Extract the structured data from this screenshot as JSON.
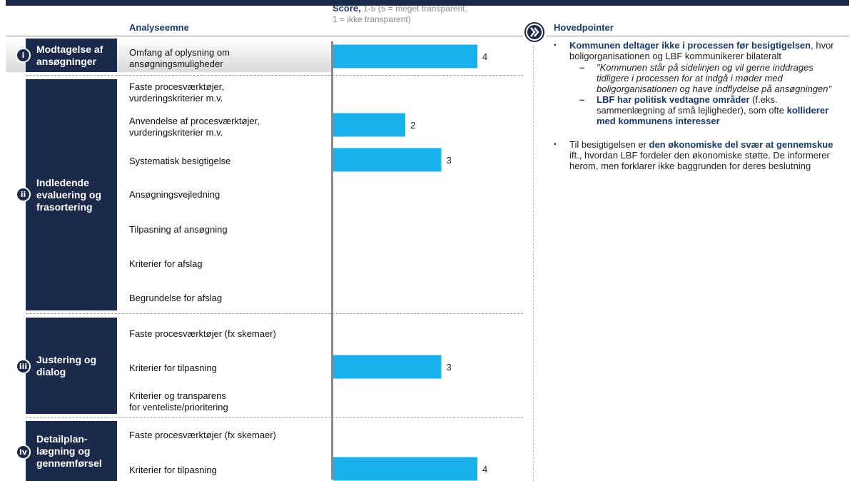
{
  "header": {
    "analyseemne": "Analyseemne",
    "score_bold": "Score,",
    "score_rest1": " 1-5 (5 = meget transparent,",
    "score_rest2": "1 = ikke transparent)",
    "hovedpointer": "Hovedpointer"
  },
  "sections": [
    {
      "roman": "i",
      "line1": "Modtagelse af",
      "line2": "ansøgninger",
      "line3": ""
    },
    {
      "roman": "ii",
      "line1": "Indledende",
      "line2": "evaluering og",
      "line3": "frasortering"
    },
    {
      "roman": "iii",
      "line1": "Justering og",
      "line2": "dialog",
      "line3": ""
    },
    {
      "roman": "iv",
      "line1": "Detailplan-",
      "line2": "lægning og",
      "line3": "gennemførsel"
    }
  ],
  "items": [
    {
      "l1": "Omfang af oplysning om",
      "l2": "ansøgningsmuligheder"
    },
    {
      "l1": "Faste procesværktøjer,",
      "l2": "vurderingskriterier m.v."
    },
    {
      "l1": "Anvendelse af procesværktøjer,",
      "l2": "vurderingskriterier m.v."
    },
    {
      "l1": "Systematisk besigtigelse",
      "l2": ""
    },
    {
      "l1": "Ansøgningsvejledning",
      "l2": ""
    },
    {
      "l1": "Tilpasning af ansøgning",
      "l2": ""
    },
    {
      "l1": "Kriterier for afslag",
      "l2": ""
    },
    {
      "l1": "Begrundelse for afslag",
      "l2": ""
    },
    {
      "l1": "Faste procesværktøjer (fx skemaer)",
      "l2": ""
    },
    {
      "l1": "Kriterier for tilpasning",
      "l2": ""
    },
    {
      "l1": "Kriterier og transparens",
      "l2": "for venteliste/prioritering"
    },
    {
      "l1": "Faste procesværktøjer (fx skemaer)",
      "l2": ""
    },
    {
      "l1": "Kriterier for tilpasning",
      "l2": ""
    }
  ],
  "chart_data": {
    "type": "bar",
    "orientation": "horizontal",
    "xlabel": "Score, 1-5 (5 = meget transparent, 1 = ikke transparent)",
    "xlim": [
      0,
      5
    ],
    "bar_color": "#1ab0ec",
    "categories": [
      "Omfang af oplysning om ansøgningsmuligheder",
      "Faste procesværktøjer, vurderingskriterier m.v.",
      "Anvendelse af procesværktøjer, vurderingskriterier m.v.",
      "Systematisk besigtigelse",
      "Ansøgningsvejledning",
      "Tilpasning af ansøgning",
      "Kriterier for afslag",
      "Begrundelse for afslag",
      "Faste procesværktøjer (fx skemaer)",
      "Kriterier for tilpasning",
      "Kriterier og transparens for venteliste/prioritering",
      "Faste procesværktøjer (fx skemaer)",
      "Kriterier for tilpasning"
    ],
    "values": [
      4,
      null,
      2,
      3,
      null,
      null,
      null,
      null,
      null,
      3,
      null,
      null,
      4
    ],
    "value_labels": [
      "4",
      "",
      "2",
      "3",
      "",
      "",
      "",
      "",
      "",
      "3",
      "",
      "",
      "4"
    ]
  },
  "notes": {
    "n1_bold": "Kommunen deltager ikke i processen før besigtigelsen",
    "n1_rest": ", hvor boligorganisationen og LBF kommunikerer bilateralt",
    "s1_dash": "–",
    "s1": "\"Kommunen står på sidelinjen og vil gerne inddrages tidligere i processen for at indgå i møder med boligorganisationen og have indflydelse på ansøgningen\"",
    "s2_dash": "–",
    "s2_bold": "LBF har politisk vedtagne områder",
    "s2_rest": " (f.eks. sammenlægning af små lejligheder), som ofte ",
    "s2_bold2": "kolliderer med kommunens interesser",
    "n2_pre": "Til besigtigelsen er ",
    "n2_bold": "den økonomiske del svær at gennemskue",
    "n2_rest": " ift., hvordan LBF fordeler den økonomiske støtte. De informerer herom, men forklarer ikke baggrunden for deres beslutning",
    "bullet": "▪"
  }
}
